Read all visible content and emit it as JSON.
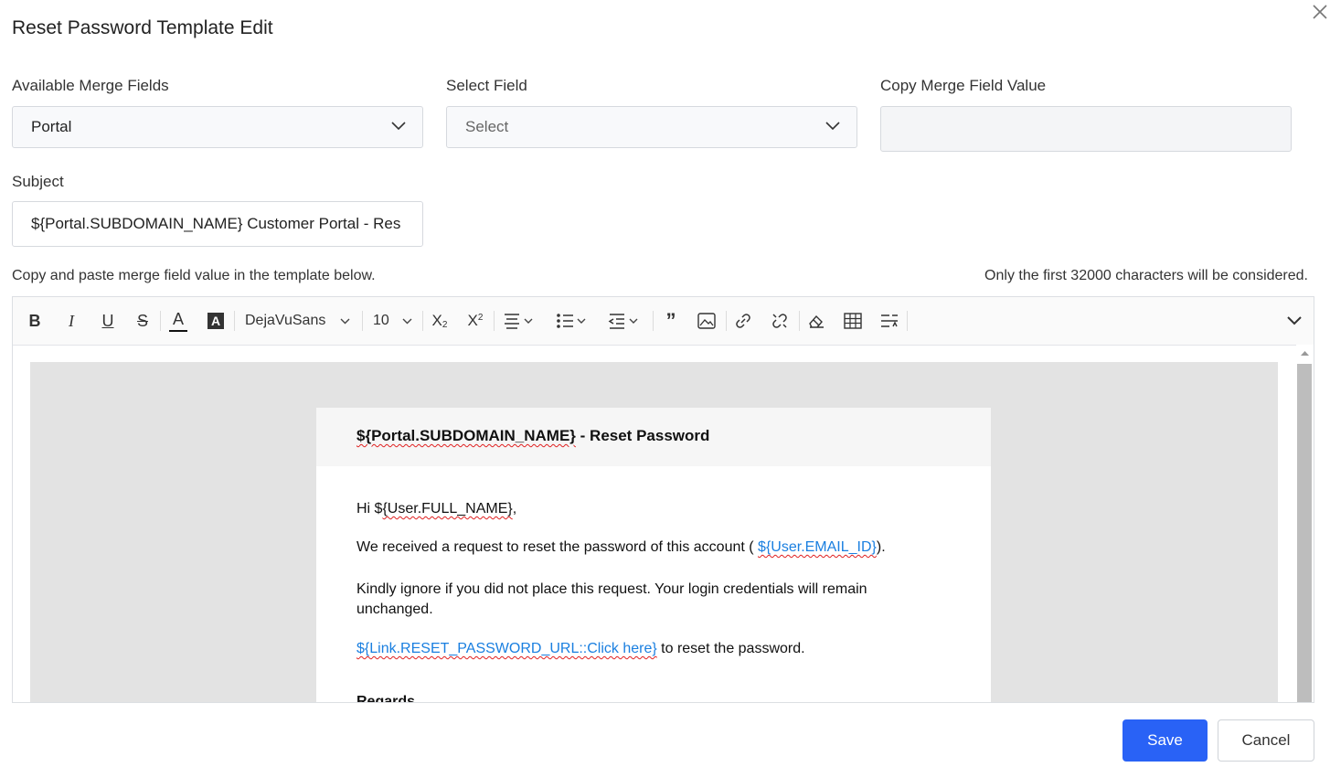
{
  "dialog": {
    "title": "Reset Password Template Edit"
  },
  "merge": {
    "available_label": "Available Merge Fields",
    "available_value": "Portal",
    "select_label": "Select Field",
    "select_placeholder": "Select",
    "copy_label": "Copy Merge Field Value",
    "copy_value": ""
  },
  "subject": {
    "label": "Subject",
    "value": "${Portal.SUBDOMAIN_NAME} Customer Portal - Res"
  },
  "hints": {
    "left": "Copy and paste merge field value in the template below.",
    "right": "Only the first 32000 characters will be considered."
  },
  "toolbar": {
    "font_family": "DejaVuSans",
    "font_size": "10",
    "icons": [
      "bold-icon",
      "italic-icon",
      "underline-icon",
      "strikethrough-icon",
      "font-color-icon",
      "highlight-icon",
      "subscript-icon",
      "superscript-icon",
      "align-icon",
      "list-icon",
      "indent-icon",
      "quote-icon",
      "image-icon",
      "link-icon",
      "unlink-icon",
      "clear-format-icon",
      "table-icon",
      "line-height-icon",
      "expand-toolbar-icon"
    ]
  },
  "email": {
    "header_var": "${Portal.SUBDOMAIN_NAME}",
    "header_suffix": " - Reset Password",
    "greeting_prefix": "Hi $",
    "greeting_var": "{User.FULL_NAME}",
    "greeting_suffix": ",",
    "line1_prefix": "We received a request to reset the password of this account ( ",
    "line1_var": "${User.EMAIL_ID}",
    "line1_suffix": ").",
    "line2": "Kindly ignore if you did not place this request. Your login credentials will remain unchanged.",
    "link_var": "${Link.RESET_PASSWORD_URL::Click here}",
    "link_suffix": " to reset the password.",
    "regards": "Regards"
  },
  "actions": {
    "save": "Save",
    "cancel": "Cancel"
  },
  "colors": {
    "primary": "#2962f6",
    "link": "#1a7fe0",
    "spell_error": "#e02020"
  }
}
